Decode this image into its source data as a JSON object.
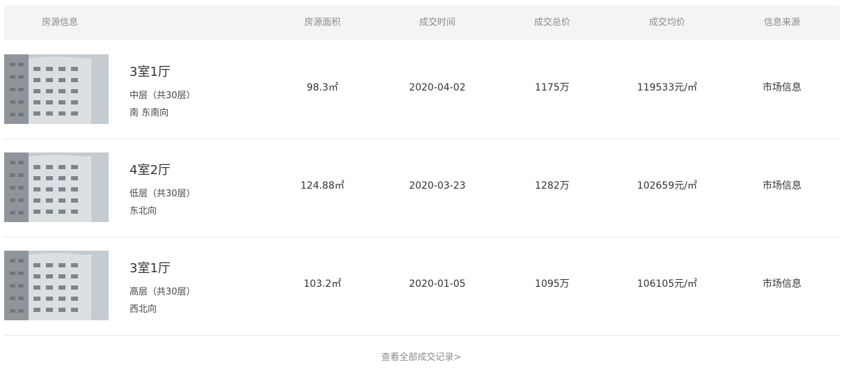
{
  "table": {
    "headers": {
      "info": "房源信息",
      "area": "房源面积",
      "time": "成交时间",
      "total": "成交总价",
      "unit": "成交均价",
      "source": "信息来源"
    },
    "rows": [
      {
        "thumbnail_icon": "building-photo",
        "title": "3室1厅",
        "floor": "中层（共30层）",
        "orientation": "南 东南向",
        "area": "98.3㎡",
        "date": "2020-04-02",
        "total_price": "1175万",
        "unit_price": "119533元/㎡",
        "source": "市场信息"
      },
      {
        "thumbnail_icon": "building-photo",
        "title": "4室2厅",
        "floor": "低层（共30层）",
        "orientation": "东北向",
        "area": "124.88㎡",
        "date": "2020-03-23",
        "total_price": "1282万",
        "unit_price": "102659元/㎡",
        "source": "市场信息"
      },
      {
        "thumbnail_icon": "building-photo",
        "title": "3室1厅",
        "floor": "高层（共30层）",
        "orientation": "西北向",
        "area": "103.2㎡",
        "date": "2020-01-05",
        "total_price": "1095万",
        "unit_price": "106105元/㎡",
        "source": "市场信息"
      }
    ]
  },
  "footer": {
    "view_all_label": "查看全部成交记录>"
  },
  "colors": {
    "header_bg": "#f4f4f4",
    "header_text": "#8a8a8a",
    "text": "#333333",
    "divider": "#e8e8e8"
  }
}
